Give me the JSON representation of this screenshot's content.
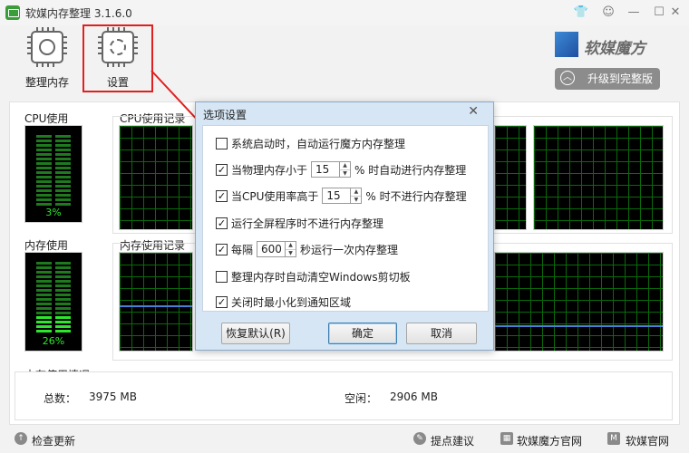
{
  "app": {
    "title": "软媒内存整理 3.1.6.0"
  },
  "window_controls": {
    "skin": "👕",
    "feedback": "☺",
    "minimize": "—",
    "maximize": "☐",
    "close": "✕"
  },
  "toolbar": {
    "organize_label": "整理内存",
    "settings_label": "设置",
    "brand": "软媒魔方",
    "upgrade_label": "升级到完整版",
    "upgrade_icon": "chevron-up-icon"
  },
  "cpu": {
    "usage_label": "CPU使用",
    "history_label": "CPU使用记录",
    "percent_text": "3%",
    "level": 0.03
  },
  "memory": {
    "usage_label": "内存使用",
    "history_label": "内存使用记录",
    "percent_text": "26%",
    "level": 0.26
  },
  "mem_info": {
    "title": "内存使用情况",
    "total_label": "总数：",
    "total_value": "3975 MB",
    "free_label": "空闲：",
    "free_value": "2906 MB"
  },
  "bottom": {
    "check_update": "检查更新",
    "suggest": "提点建议",
    "website": "软媒魔方官网",
    "official": "软媒官网"
  },
  "dialog": {
    "title": "选项设置",
    "close": "✕",
    "options": [
      {
        "checked": false,
        "label": "系统启动时，自动运行魔方内存整理"
      },
      {
        "checked": true,
        "label_before": "当物理内存小于",
        "value": "15",
        "label_after": "% 时自动进行内存整理"
      },
      {
        "checked": true,
        "label_before": "当CPU使用率高于",
        "value": "15",
        "label_after": "% 时不进行内存整理"
      },
      {
        "checked": true,
        "label": "运行全屏程序时不进行内存整理"
      },
      {
        "checked": true,
        "label_before": "每隔",
        "value": "600",
        "label_after": "秒运行一次内存整理"
      },
      {
        "checked": false,
        "label": "整理内存时自动清空Windows剪切板"
      },
      {
        "checked": true,
        "label": "关闭时最小化到通知区域"
      }
    ],
    "restore_label": "恢复默认(R)",
    "ok_label": "确定",
    "cancel_label": "取消"
  },
  "colors": {
    "accent_red": "#e02020",
    "meter_green": "#2ee52e",
    "grid_green": "#0a6a0a",
    "memory_line": "#4a7fd8"
  }
}
